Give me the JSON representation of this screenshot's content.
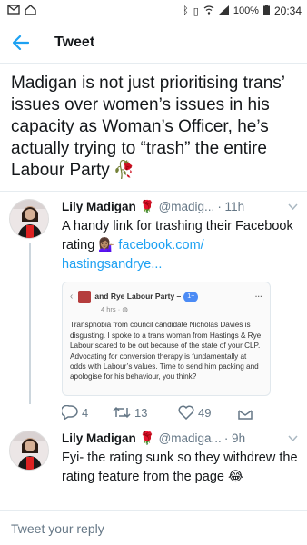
{
  "status": {
    "battery": "100%",
    "time": "20:34"
  },
  "appbar": {
    "title": "Tweet"
  },
  "main_tweet": {
    "text": "Madigan is not just prioritising trans’ issues over women’s issues in his capacity as Woman’s Officer, he’s actually trying to “trash” the entire Labour Party",
    "emoji": "🥀"
  },
  "replies": [
    {
      "name": "Lily Madigan",
      "emoji": "🌹",
      "handle": "@madig...",
      "time": "· 11h",
      "text_before": "A handy link for trashing their Facebook rating",
      "text_emoji": "💁🏽‍♀️",
      "link": "facebook.com/ hastingsandrye...",
      "embed": {
        "page_name": "and Rye Labour Party –",
        "badge": "1+",
        "sub": "4 hrs · ",
        "body": "Transphobia from council candidate Nicholas Davies is disgusting. I spoke to a trans woman from Hastings & Rye Labour scared to be out because of the state of your CLP. Advocating for conversion therapy is fundamentally at odds with Labour’s values. Time to send him packing and apologise for his behaviour, you think?"
      },
      "replies_count": "4",
      "retweets_count": "13",
      "likes_count": "49"
    },
    {
      "name": "Lily Madigan",
      "emoji": "🌹",
      "handle": "@madiga...",
      "time": "· 9h",
      "text_before": "Fyi- the rating sunk so they withdrew the rating feature from the page",
      "text_emoji": "😂"
    }
  ],
  "reply_box": {
    "placeholder": "Tweet your reply"
  }
}
